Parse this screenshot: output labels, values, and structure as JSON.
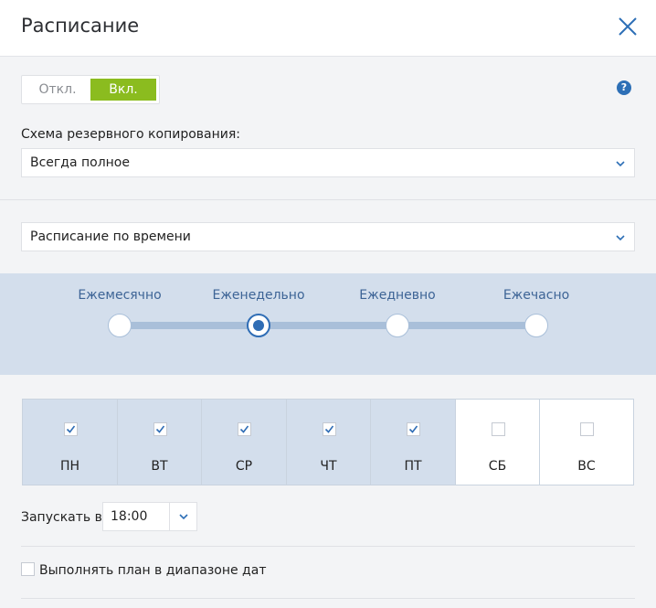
{
  "header": {
    "title": "Расписание",
    "close_icon": "close-icon"
  },
  "toggle": {
    "off_label": "Откл.",
    "on_label": "Вкл.",
    "state": "on",
    "accent": "#8bbc1f"
  },
  "help": {
    "icon": "question-icon",
    "glyph": "?"
  },
  "backup_scheme": {
    "label": "Схема резервного копирования:",
    "value": "Всегда полное"
  },
  "schedule_type": {
    "value": "Расписание по времени"
  },
  "frequency": {
    "options": [
      "Ежемесячно",
      "Еженедельно",
      "Ежедневно",
      "Ежечасно"
    ],
    "selected": "Еженедельно"
  },
  "days": [
    {
      "label": "ПН",
      "checked": true
    },
    {
      "label": "ВТ",
      "checked": true
    },
    {
      "label": "СР",
      "checked": true
    },
    {
      "label": "ЧТ",
      "checked": true
    },
    {
      "label": "ПТ",
      "checked": true
    },
    {
      "label": "СБ",
      "checked": false
    },
    {
      "label": "ВС",
      "checked": false
    }
  ],
  "start": {
    "label": "Запускать в:",
    "value": "18:00"
  },
  "date_range": {
    "label": "Выполнять план в диапазоне дат",
    "checked": false
  },
  "colors": {
    "primary": "#2f6db5",
    "band": "#d3deec",
    "track": "#a9bfd9"
  }
}
